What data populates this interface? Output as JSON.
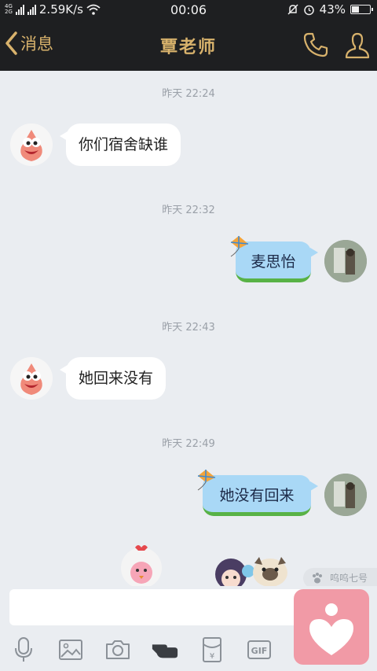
{
  "status_bar": {
    "net_top": "4G",
    "net_bottom": "2G",
    "speed": "2.59K/s",
    "time": "00:06",
    "battery": "43%",
    "battery_level": 0.43
  },
  "header": {
    "back_label": "消息",
    "title": "覃老师"
  },
  "messages": [
    {
      "time": "昨天 22:24",
      "from": "other",
      "text": "你们宿舍缺谁"
    },
    {
      "time": "昨天 22:32",
      "from": "me",
      "text": "麦思怡"
    },
    {
      "time": "昨天 22:43",
      "from": "other",
      "text": "她回来没有"
    },
    {
      "time": "昨天 22:49",
      "from": "me",
      "text": "她没有回来"
    }
  ],
  "sticker_hint": "呜呜七号",
  "input": {
    "value": "",
    "placeholder": ""
  },
  "toolbar": {
    "gif_label": "GIF",
    "yuan_label": "¥"
  },
  "colors": {
    "header_bg": "#1e1f21",
    "header_accent": "#d8b26c",
    "chat_bg": "#eaedf1",
    "bubble_out": "#a9d8f6",
    "float_button": "#f19aa6"
  }
}
